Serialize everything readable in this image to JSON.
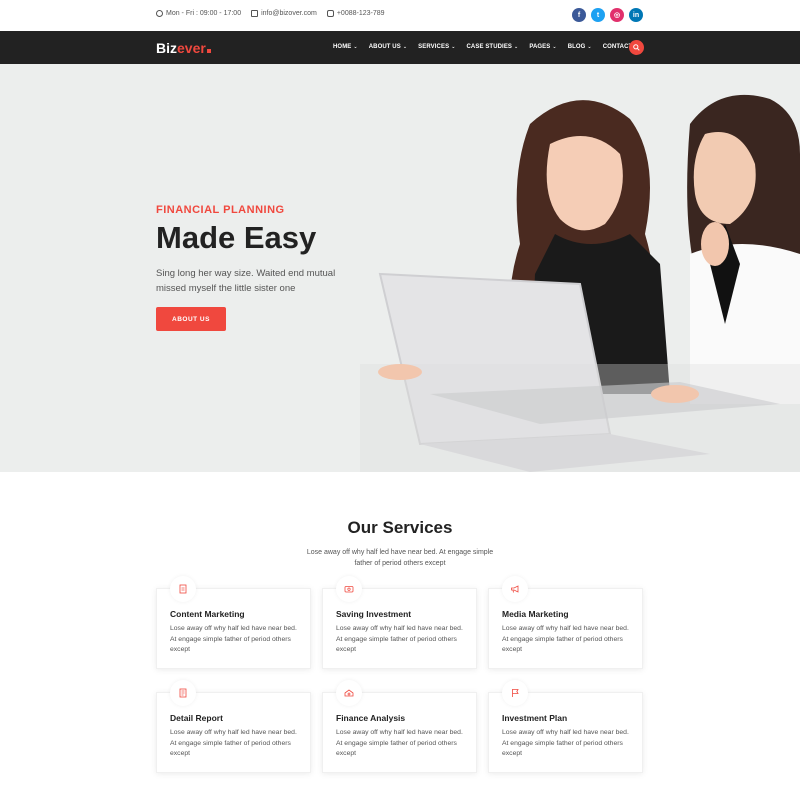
{
  "topbar": {
    "hours": "Mon - Fri : 09:00 - 17:00",
    "email": "info@bizover.com",
    "phone": "+0088-123-789",
    "social": [
      {
        "icon": "facebook-icon",
        "label": "f",
        "color": "#3b5998"
      },
      {
        "icon": "twitter-icon",
        "label": "t",
        "color": "#1da1f2"
      },
      {
        "icon": "instagram-icon",
        "label": "◎",
        "color": "#e1306c"
      },
      {
        "icon": "linkedin-icon",
        "label": "in",
        "color": "#0077b5"
      }
    ]
  },
  "nav": {
    "logo_main": "Biz",
    "logo_accent": "ever",
    "items": [
      {
        "label": "HOME",
        "dropdown": true
      },
      {
        "label": "ABOUT US",
        "dropdown": true
      },
      {
        "label": "SERVICES",
        "dropdown": true
      },
      {
        "label": "CASE STUDIES",
        "dropdown": true
      },
      {
        "label": "PAGES",
        "dropdown": true
      },
      {
        "label": "BLOG",
        "dropdown": true
      },
      {
        "label": "CONTACT",
        "dropdown": false
      }
    ],
    "search_icon": "search-icon"
  },
  "hero": {
    "eyebrow": "FINANCIAL PLANNING",
    "title": "Made Easy",
    "subtitle": "Sing long her way size. Waited end mutual missed myself the little sister one",
    "cta": "ABOUT US"
  },
  "services": {
    "title": "Our Services",
    "subtitle": "Lose away off why half led have near bed. At engage simple father of period others except",
    "cards": [
      {
        "title": "Content Marketing",
        "desc": "Lose away off why half led have near bed. At engage simple father of period others except",
        "icon": "document-icon"
      },
      {
        "title": "Saving Investment",
        "desc": "Lose away off why half led have near bed. At engage simple father of period others except",
        "icon": "wallet-icon"
      },
      {
        "title": "Media Marketing",
        "desc": "Lose away off why half led have near bed. At engage simple father of period others except",
        "icon": "megaphone-icon"
      },
      {
        "title": "Detail Report",
        "desc": "Lose away off why half led have near bed. At engage simple father of period others except",
        "icon": "report-icon"
      },
      {
        "title": "Finance Analysis",
        "desc": "Lose away off why half led have near bed. At engage simple father of period others except",
        "icon": "money-icon"
      },
      {
        "title": "Investment Plan",
        "desc": "Lose away off why half led have near bed. At engage simple father of period others except",
        "icon": "flag-icon"
      }
    ]
  },
  "colors": {
    "accent": "#f0483e",
    "nav_bg": "#222222",
    "hero_bg": "#eceeed"
  }
}
